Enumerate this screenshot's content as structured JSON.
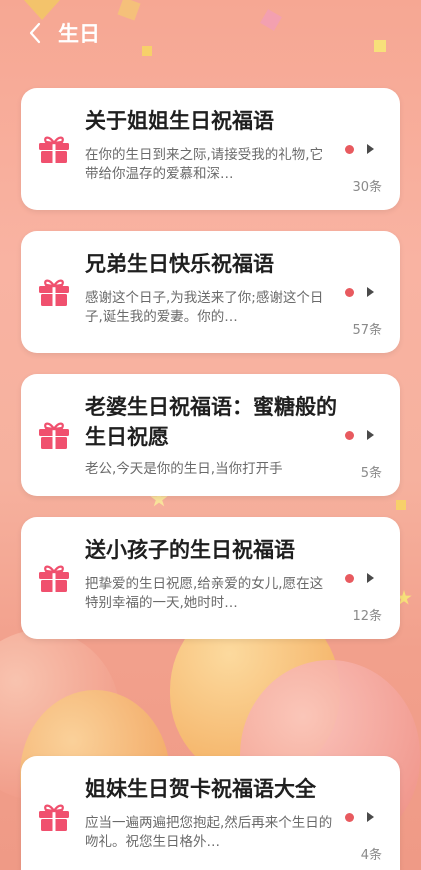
{
  "header": {
    "title": "生日"
  },
  "cards": [
    {
      "title": "关于姐姐生日祝福语",
      "desc": "在你的生日到来之际,请接受我的礼物,它带给你温存的爱慕和深…",
      "count": "30条"
    },
    {
      "title": "兄弟生日快乐祝福语",
      "desc": "感谢这个日子,为我送来了你;感谢这个日子,诞生我的爱妻。你的…",
      "count": "57条"
    },
    {
      "title": "老婆生日祝福语：蜜糖般的生日祝愿",
      "desc": "老公,今天是你的生日,当你打开手",
      "count": "5条"
    },
    {
      "title": "送小孩子的生日祝福语",
      "desc": "把挚爱的生日祝愿,给亲爱的女儿,愿在这特别幸福的一天,她时时…",
      "count": "12条"
    },
    {
      "title": "姐妹生日贺卡祝福语大全",
      "desc": "应当一遍两遍把您抱起,然后再来个生日的吻礼。祝您生日格外…",
      "count": "4条"
    }
  ],
  "colors": {
    "accent": "#e85a5f",
    "gift": "#f0506e"
  },
  "icons": [
    "back-arrow-icon",
    "gift-icon",
    "chevron-right-icon",
    "unread-dot-icon"
  ]
}
